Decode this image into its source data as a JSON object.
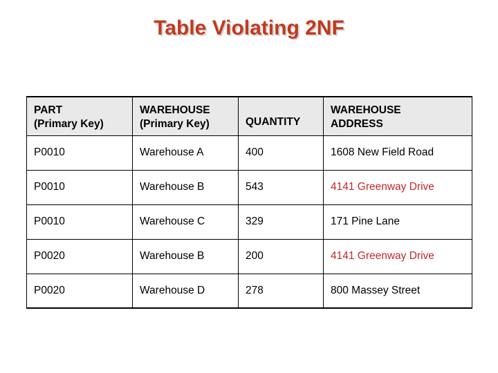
{
  "slide": {
    "title": "Table Violating 2NF",
    "title_color": "#C03A1E",
    "background_color": "#FFFFFF"
  },
  "table": {
    "header_background": "#E9E9E9",
    "border_color": "#000000",
    "highlight_color": "#BE2A2A",
    "columns": [
      {
        "key": "part",
        "line1": "PART",
        "line2": "(Primary Key)",
        "align": "top"
      },
      {
        "key": "warehouse",
        "line1": "WAREHOUSE",
        "line2": "(Primary Key)",
        "align": "top"
      },
      {
        "key": "quantity",
        "line1": "QUANTITY",
        "line2": "",
        "align": "bottom"
      },
      {
        "key": "address",
        "line1": "WAREHOUSE",
        "line2": "ADDRESS",
        "align": "top"
      }
    ],
    "rows": [
      {
        "part": "P0010",
        "warehouse": "Warehouse A",
        "quantity": "400",
        "address": "1608 New Field Road",
        "address_color": "#000000"
      },
      {
        "part": "P0010",
        "warehouse": "Warehouse B",
        "quantity": "543",
        "address": "4141 Greenway Drive",
        "address_color": "#BE2A2A"
      },
      {
        "part": "P0010",
        "warehouse": "Warehouse C",
        "quantity": "329",
        "address": "171 Pine Lane",
        "address_color": "#000000"
      },
      {
        "part": "P0020",
        "warehouse": "Warehouse B",
        "quantity": "200",
        "address": "4141 Greenway Drive",
        "address_color": "#BE2A2A"
      },
      {
        "part": "P0020",
        "warehouse": "Warehouse D",
        "quantity": "278",
        "address": "800 Massey Street",
        "address_color": "#000000"
      }
    ]
  }
}
